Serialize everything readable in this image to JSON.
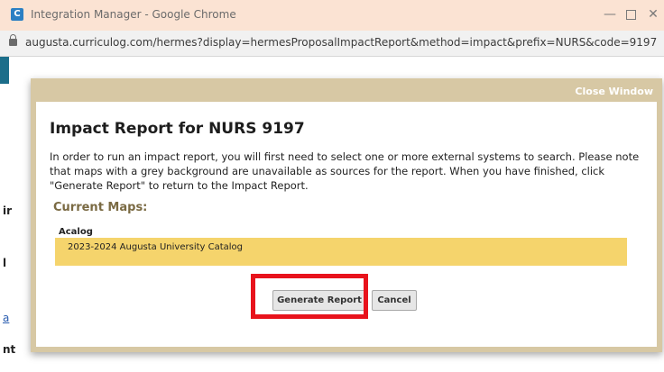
{
  "window": {
    "app_icon_letter": "C",
    "title": "Integration Manager - Google Chrome",
    "minimize_glyph": "—",
    "close_glyph": "✕"
  },
  "address": {
    "url": "augusta.curriculog.com/hermes?display=hermesProposalImpactReport&method=impact&prefix=NURS&code=9197"
  },
  "background_page": {
    "fragments": [
      "ir",
      "l",
      "a",
      "nt"
    ]
  },
  "modal": {
    "close_label": "Close Window",
    "title": "Impact Report for NURS 9197",
    "description": "In order to run an impact report, you will first need to select one or more external systems to search. Please note that maps with a grey background are unavailable as sources for the report. When you have finished, click \"Generate Report\" to return to the Impact Report.",
    "section_title": "Current Maps:",
    "group_label": "Acalog",
    "maps": [
      "2023-2024 Augusta University Catalog"
    ],
    "generate_label": "Generate Report",
    "cancel_label": "Cancel"
  },
  "colors": {
    "modal_border": "#d7c8a4",
    "map_row": "#f5d46c",
    "highlight": "#e8131c",
    "titlebar": "#fbe3d3"
  }
}
